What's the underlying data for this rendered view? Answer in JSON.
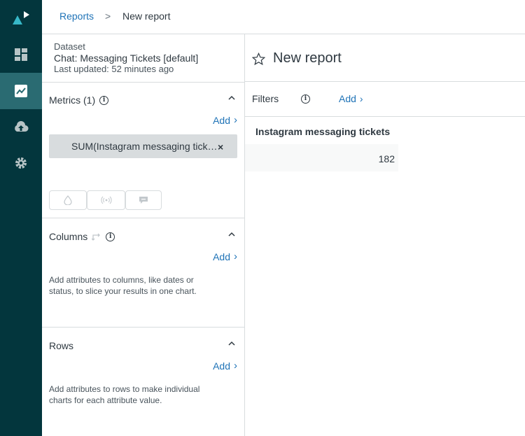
{
  "nav": {
    "items": [
      "logo-icon",
      "dashboard-icon",
      "reports-icon",
      "upload-icon",
      "settings-icon"
    ],
    "active": "reports-icon",
    "bg_color": "#03363d"
  },
  "breadcrumb": {
    "parent": "Reports",
    "separator": ">",
    "current": "New report"
  },
  "dataset": {
    "label": "Dataset",
    "name": "Chat: Messaging Tickets [default]",
    "updated": "Last updated: 52 minutes ago"
  },
  "metrics": {
    "title": "Metrics (1)",
    "add_label": "Add",
    "items": [
      "SUM(Instagram messaging tickets)"
    ],
    "icons": [
      "drop-icon",
      "broadcast-icon",
      "comment-icon"
    ]
  },
  "columns": {
    "title": "Columns",
    "add_label": "Add",
    "help": "Add attributes to columns, like dates or status, to slice your results in one chart."
  },
  "rows": {
    "title": "Rows",
    "add_label": "Add",
    "help": "Add attributes to rows to make individual charts for each attribute value."
  },
  "report": {
    "title": "New report",
    "filters_label": "Filters",
    "filters_add": "Add",
    "table": {
      "header": "Instagram messaging tickets",
      "value": "182"
    }
  },
  "colors": {
    "link": "#1f73b7",
    "text": "#2f3941",
    "border": "#d8dcde"
  }
}
